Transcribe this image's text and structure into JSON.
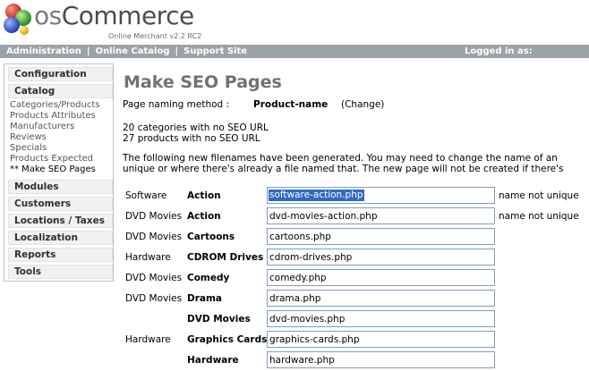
{
  "header": {
    "brand_prefix": "os",
    "brand_main": "Commerce",
    "tagline": "Online Merchant v2.2 RC2"
  },
  "navbar": {
    "links": [
      "Administration",
      "Online Catalog",
      "Support Site"
    ],
    "separator": "|",
    "login_text": "Logged in as:"
  },
  "sidebar": {
    "sections": [
      "Configuration",
      "Catalog",
      "Modules",
      "Customers",
      "Locations / Taxes",
      "Localization",
      "Reports",
      "Tools"
    ],
    "catalog_links": [
      "Categories/Products",
      "Products Attributes",
      "Manufacturers",
      "Reviews",
      "Specials",
      "Products Expected",
      "** Make SEO Pages"
    ]
  },
  "main": {
    "title": "Make SEO Pages",
    "naming_label": "Page naming method :",
    "naming_value": "Product-name",
    "change_link": "(Change)",
    "counts": [
      "20 categories with no SEO URL",
      "27 products with no SEO URL"
    ],
    "info_lines": [
      "The following new filenames have been generated. You may need to change the name of an",
      "unique or where there's already a file named that. The new page will not be created if there's"
    ],
    "rows": [
      {
        "category": "Software",
        "name": "Action",
        "filename": "software-action.php",
        "note": "name not unique"
      },
      {
        "category": "DVD Movies",
        "name": "Action",
        "filename": "dvd-movies-action.php",
        "note": "name not unique"
      },
      {
        "category": "DVD Movies",
        "name": "Cartoons",
        "filename": "cartoons.php",
        "note": ""
      },
      {
        "category": "Hardware",
        "name": "CDROM Drives",
        "filename": "cdrom-drives.php",
        "note": ""
      },
      {
        "category": "DVD Movies",
        "name": "Comedy",
        "filename": "comedy.php",
        "note": ""
      },
      {
        "category": "DVD Movies",
        "name": "Drama",
        "filename": "drama.php",
        "note": ""
      },
      {
        "category": "",
        "name": "DVD Movies",
        "filename": "dvd-movies.php",
        "note": ""
      },
      {
        "category": "Hardware",
        "name": "Graphics Cards",
        "filename": "graphics-cards.php",
        "note": ""
      },
      {
        "category": "",
        "name": "Hardware",
        "filename": "hardware.php",
        "note": ""
      }
    ]
  },
  "colors": {
    "navbar_bg": "#9ba3a6",
    "title": "#727272",
    "selection": "#316ac5"
  }
}
